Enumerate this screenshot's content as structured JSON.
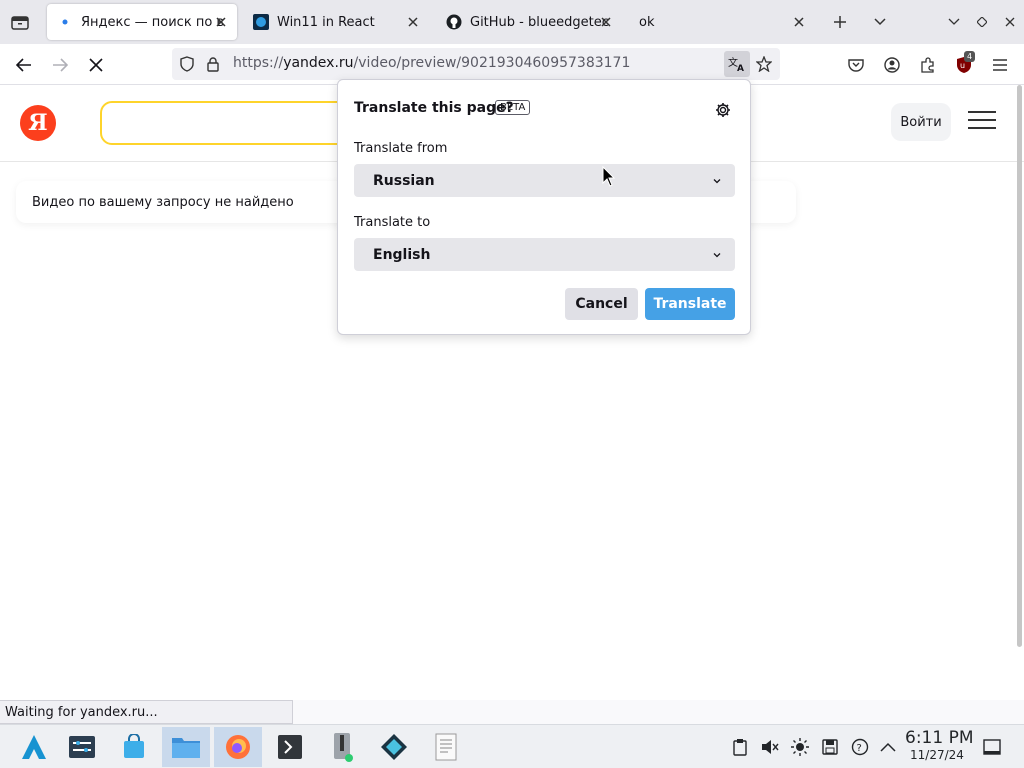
{
  "tabs": [
    {
      "title": "Яндекс — поиск по в",
      "active": true,
      "favicon": "yandex-dot-icon"
    },
    {
      "title": "Win11 in React",
      "active": false,
      "favicon": "win11-icon"
    },
    {
      "title": "GitHub - blueedgetec",
      "active": false,
      "favicon": "github-icon"
    },
    {
      "title": "ok",
      "active": false,
      "favicon": ""
    }
  ],
  "urlbar": {
    "prefix": "https://",
    "host": "yandex.ru",
    "path": "/video/preview/9021930460957383171"
  },
  "extensions": {
    "badge_count": "4"
  },
  "page": {
    "login_label": "Войти",
    "not_found_message": "Видео по вашему запросу не найдено",
    "logo_letter": "Я"
  },
  "popup": {
    "title": "Translate this page?",
    "beta_label": "BETA",
    "from_label": "Translate from",
    "from_value": "Russian",
    "to_label": "Translate to",
    "to_value": "English",
    "cancel_label": "Cancel",
    "translate_label": "Translate"
  },
  "status_text": "Waiting for yandex.ru...",
  "taskbar": {
    "time": "6:11 PM",
    "date": "11/27/24"
  },
  "colors": {
    "accent": "#45a1e6",
    "yandex_red": "#fc3f1d",
    "search_border": "#fed42b"
  }
}
